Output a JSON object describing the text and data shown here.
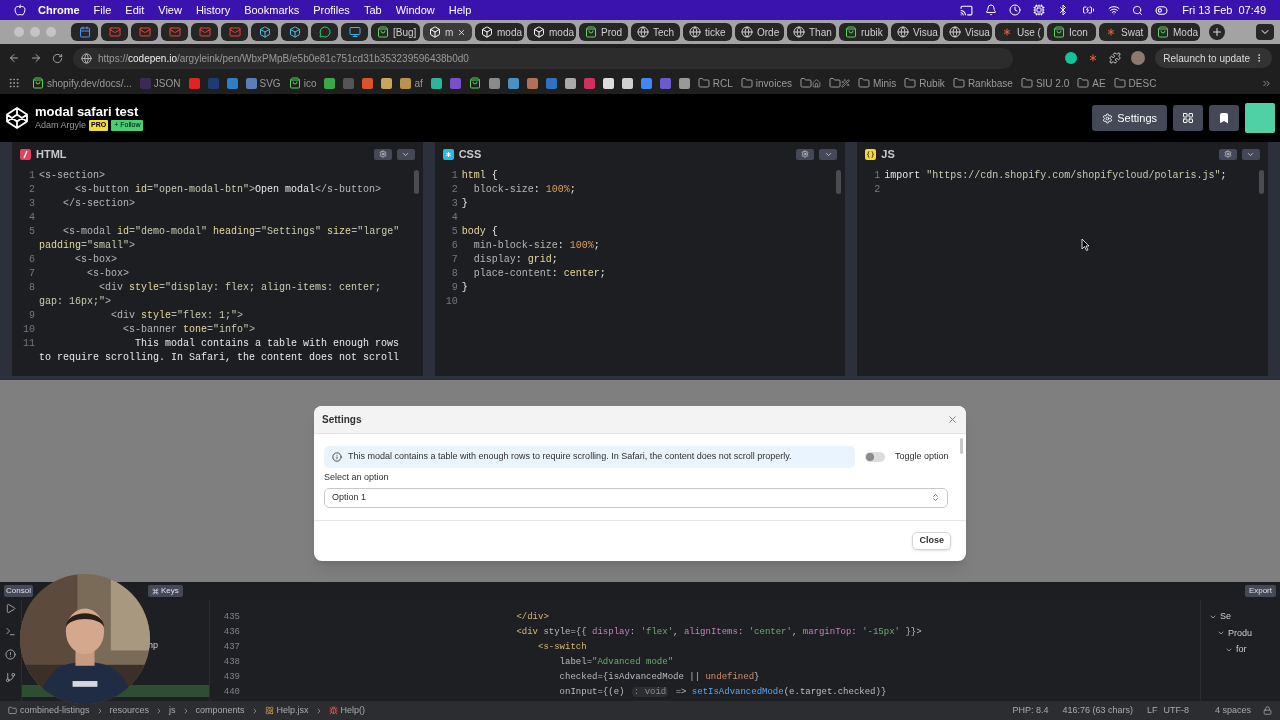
{
  "menubar": {
    "app": "Chrome",
    "items": [
      "File",
      "Edit",
      "View",
      "History",
      "Bookmarks",
      "Profiles",
      "Tab",
      "Window",
      "Help"
    ],
    "date": "Fri 13 Feb",
    "time": "07:49"
  },
  "tabs": [
    {
      "kind": "calendar",
      "selected": false
    },
    {
      "kind": "mail",
      "selected": false
    },
    {
      "kind": "mail",
      "selected": false
    },
    {
      "kind": "mail",
      "selected": false
    },
    {
      "kind": "mail",
      "selected": false
    },
    {
      "kind": "mail",
      "selected": false
    },
    {
      "kind": "cube",
      "selected": false
    },
    {
      "kind": "cube",
      "selected": false
    },
    {
      "kind": "chat",
      "selected": false
    },
    {
      "kind": "screen",
      "selected": false
    },
    {
      "kind": "shopify",
      "label": "[Bug]",
      "selected": false
    },
    {
      "kind": "codepen",
      "label": "m",
      "selected": true
    },
    {
      "kind": "codepen",
      "label": "moda",
      "selected": false
    },
    {
      "kind": "codepen",
      "label": "moda",
      "selected": false
    },
    {
      "kind": "shopify",
      "label": "Prod",
      "selected": false
    },
    {
      "kind": "globe",
      "label": "Tech",
      "selected": false
    },
    {
      "kind": "globe",
      "label": "ticke",
      "selected": false
    },
    {
      "kind": "globe",
      "label": "Orde",
      "selected": false
    },
    {
      "kind": "globe",
      "label": "Than",
      "selected": false
    },
    {
      "kind": "shopify",
      "label": "rubik",
      "selected": false
    },
    {
      "kind": "globe",
      "label": "Visua",
      "selected": false
    },
    {
      "kind": "globe",
      "label": "Visua",
      "selected": false
    },
    {
      "kind": "star",
      "label": "Use (",
      "selected": false
    },
    {
      "kind": "shopify",
      "label": "Icon",
      "selected": false
    },
    {
      "kind": "star",
      "label": "Swat",
      "selected": false
    },
    {
      "kind": "shopify",
      "label": "Moda",
      "selected": false
    }
  ],
  "address": {
    "scheme": "https://",
    "host": "codepen.io",
    "path": "/argyleink/pen/WbxPMpB/e5b0e81c751cd31b353239596438b0d0",
    "relaunch": "Relaunch to update"
  },
  "bookmarks": [
    {
      "kind": "shopify",
      "label": "shopify.dev/docs/..."
    },
    {
      "kind": "square",
      "color": "#3b2a55",
      "label": "JSON"
    },
    {
      "kind": "square",
      "color": "#e02424"
    },
    {
      "kind": "square",
      "color": "#1f3b73"
    },
    {
      "kind": "square",
      "color": "#2f7fc4"
    },
    {
      "kind": "square",
      "color": "#5a7fb8",
      "label": "SVG"
    },
    {
      "kind": "shopify",
      "label": "ico"
    },
    {
      "kind": "square",
      "color": "#3aa845"
    },
    {
      "kind": "square",
      "color": "#555555"
    },
    {
      "kind": "square",
      "color": "#d9542b"
    },
    {
      "kind": "square",
      "color": "#c9a45a"
    },
    {
      "kind": "square",
      "color": "#b8924e",
      "label": "af"
    },
    {
      "kind": "square",
      "color": "#2bb59a"
    },
    {
      "kind": "square",
      "color": "#7b4fc9"
    },
    {
      "kind": "shopify"
    },
    {
      "kind": "square",
      "color": "#8a8a8a"
    },
    {
      "kind": "square",
      "color": "#4a90c2"
    },
    {
      "kind": "square",
      "color": "#b0705a"
    },
    {
      "kind": "square",
      "color": "#3070c0"
    },
    {
      "kind": "square",
      "color": "#aaaaaa"
    },
    {
      "kind": "square",
      "color": "#d03060"
    },
    {
      "kind": "square",
      "color": "#dddddd"
    },
    {
      "kind": "square",
      "color": "#cfcfcf"
    },
    {
      "kind": "square",
      "color": "#4285f4"
    },
    {
      "kind": "square",
      "color": "#6a5acd"
    },
    {
      "kind": "square",
      "color": "#999999"
    },
    {
      "kind": "folder",
      "label": "RCL"
    },
    {
      "kind": "folder",
      "label": "invoices"
    },
    {
      "kind": "folder-house"
    },
    {
      "kind": "folder-wand"
    },
    {
      "kind": "folder",
      "label": "Minis"
    },
    {
      "kind": "folder",
      "label": "Rubik"
    },
    {
      "kind": "folder",
      "label": "Rankbase"
    },
    {
      "kind": "folder",
      "label": "SIU 2.0"
    },
    {
      "kind": "folder",
      "label": "AE"
    },
    {
      "kind": "folder",
      "label": "DESC"
    }
  ],
  "pen": {
    "title": "modal safari test",
    "author": "Adam Argyle",
    "badge": "PRO",
    "follow": "+ Follow",
    "settings": "Settings"
  },
  "editors": [
    {
      "kind": "html",
      "name": "HTML",
      "rows": [
        {
          "n": "1",
          "seg": [
            {
              "kind": "tag",
              "text": "<s-section>"
            }
          ]
        },
        {
          "n": "2",
          "seg": [
            {
              "kind": "tag",
              "text": "      <s-button"
            },
            {
              "kind": "attr",
              "text": " id"
            },
            {
              "kind": "tag",
              "text": "="
            },
            {
              "kind": "str",
              "text": "\"open-modal-btn\""
            },
            {
              "kind": "tag",
              "text": ">"
            },
            {
              "kind": "text",
              "text": "Open modal"
            },
            {
              "kind": "tag",
              "text": "</s-button>"
            }
          ]
        },
        {
          "n": "3",
          "seg": [
            {
              "kind": "tag",
              "text": "    </s-section>"
            }
          ]
        },
        {
          "n": "4",
          "seg": []
        },
        {
          "n": "5",
          "seg": [
            {
              "kind": "tag",
              "text": "    <s-modal"
            },
            {
              "kind": "attr",
              "text": " id"
            },
            {
              "kind": "tag",
              "text": "="
            },
            {
              "kind": "str",
              "text": "\"demo-modal\""
            },
            {
              "kind": "attr",
              "text": " heading"
            },
            {
              "kind": "tag",
              "text": "="
            },
            {
              "kind": "str",
              "text": "\"Settings\""
            },
            {
              "kind": "attr",
              "text": " size"
            },
            {
              "kind": "tag",
              "text": "="
            },
            {
              "kind": "str",
              "text": "\"large\""
            }
          ]
        },
        {
          "seg": [
            {
              "kind": "attr",
              "text": "padding"
            },
            {
              "kind": "tag",
              "text": "="
            },
            {
              "kind": "str",
              "text": "\"small\""
            },
            {
              "kind": "tag",
              "text": ">"
            }
          ]
        },
        {
          "n": "6",
          "seg": [
            {
              "kind": "tag",
              "text": "      <s-box>"
            }
          ]
        },
        {
          "n": "7",
          "seg": [
            {
              "kind": "tag",
              "text": "        <s-box>"
            }
          ]
        },
        {
          "n": "8",
          "seg": [
            {
              "kind": "tag",
              "text": "          <div"
            },
            {
              "kind": "attr",
              "text": " style"
            },
            {
              "kind": "tag",
              "text": "="
            },
            {
              "kind": "str",
              "text": "\"display: flex; align-items: center;"
            }
          ]
        },
        {
          "seg": [
            {
              "kind": "str",
              "text": "gap: 16px;\""
            },
            {
              "kind": "tag",
              "text": ">"
            }
          ]
        },
        {
          "n": "9",
          "seg": [
            {
              "kind": "tag",
              "text": "            <div"
            },
            {
              "kind": "attr",
              "text": " style"
            },
            {
              "kind": "tag",
              "text": "="
            },
            {
              "kind": "str",
              "text": "\"flex: 1;\""
            },
            {
              "kind": "tag",
              "text": ">"
            }
          ]
        },
        {
          "n": "10",
          "seg": [
            {
              "kind": "tag",
              "text": "              <s-banner"
            },
            {
              "kind": "attr",
              "text": " tone"
            },
            {
              "kind": "tag",
              "text": "="
            },
            {
              "kind": "str",
              "text": "\"info\""
            },
            {
              "kind": "tag",
              "text": ">"
            }
          ]
        },
        {
          "n": "11",
          "seg": [
            {
              "kind": "text",
              "text": "                This modal contains a table with enough rows"
            }
          ]
        },
        {
          "seg": [
            {
              "kind": "text",
              "text": "to require scrolling. In Safari, the content does not scroll"
            }
          ]
        }
      ]
    },
    {
      "kind": "css",
      "name": "CSS",
      "rows": [
        {
          "n": "1",
          "seg": [
            {
              "kind": "attr",
              "text": "html"
            },
            {
              "kind": "text",
              "text": " {"
            }
          ]
        },
        {
          "n": "2",
          "seg": [
            {
              "kind": "tag",
              "text": "  block-size"
            },
            {
              "kind": "text",
              "text": ": "
            },
            {
              "kind": "num",
              "text": "100%"
            },
            {
              "kind": "text",
              "text": ";"
            }
          ]
        },
        {
          "n": "3",
          "seg": [
            {
              "kind": "text",
              "text": "}"
            }
          ]
        },
        {
          "n": "4",
          "seg": []
        },
        {
          "n": "5",
          "seg": [
            {
              "kind": "attr",
              "text": "body"
            },
            {
              "kind": "text",
              "text": " {"
            }
          ]
        },
        {
          "n": "6",
          "seg": [
            {
              "kind": "tag",
              "text": "  min-block-size"
            },
            {
              "kind": "text",
              "text": ": "
            },
            {
              "kind": "num",
              "text": "100%"
            },
            {
              "kind": "text",
              "text": ";"
            }
          ]
        },
        {
          "n": "7",
          "seg": [
            {
              "kind": "tag",
              "text": "  display"
            },
            {
              "kind": "text",
              "text": ": "
            },
            {
              "kind": "attr",
              "text": "grid"
            },
            {
              "kind": "text",
              "text": ";"
            }
          ]
        },
        {
          "n": "8",
          "seg": [
            {
              "kind": "tag",
              "text": "  place-content"
            },
            {
              "kind": "text",
              "text": ": "
            },
            {
              "kind": "attr",
              "text": "center"
            },
            {
              "kind": "text",
              "text": ";"
            }
          ]
        },
        {
          "n": "9",
          "seg": [
            {
              "kind": "text",
              "text": "}"
            }
          ]
        },
        {
          "n": "10",
          "seg": []
        }
      ]
    },
    {
      "kind": "js",
      "name": "JS",
      "rows": [
        {
          "n": "1",
          "seg": [
            {
              "kind": "text",
              "text": "import "
            },
            {
              "kind": "str",
              "text": "\"https://cdn.shopify.com/shopifycloud/polaris.js\""
            },
            {
              "kind": "text",
              "text": ";"
            }
          ]
        },
        {
          "n": "2",
          "seg": []
        }
      ]
    }
  ],
  "modal": {
    "title": "Settings",
    "banner": "This modal contains a table with enough rows to require scrolling. In Safari, the content does not scroll properly.",
    "toggle": {
      "label": "Toggle option",
      "on": false
    },
    "select": {
      "label": "Select an option",
      "value": "Option 1"
    },
    "close": "Close"
  },
  "pen_footer": {
    "console": "Consol",
    "keys": "Keys",
    "export": "Export"
  },
  "ide": {
    "file_item": "hp",
    "lines": [
      {
        "n": "435",
        "seg": [
          {
            "kind": "itag",
            "text": "                </div>"
          }
        ]
      },
      {
        "n": "436",
        "seg": [
          {
            "kind": "itag",
            "text": "                <div"
          },
          {
            "kind": "iattr",
            "text": " style"
          },
          {
            "kind": "itext",
            "text": "={{ "
          },
          {
            "kind": "field",
            "text": "display"
          },
          {
            "kind": "itext",
            "text": ": "
          },
          {
            "kind": "istr",
            "text": "'flex'"
          },
          {
            "kind": "itext",
            "text": ", "
          },
          {
            "kind": "field",
            "text": "alignItems"
          },
          {
            "kind": "itext",
            "text": ": "
          },
          {
            "kind": "istr",
            "text": "'center'"
          },
          {
            "kind": "itext",
            "text": ", "
          },
          {
            "kind": "field",
            "text": "marginTop"
          },
          {
            "kind": "itext",
            "text": ": "
          },
          {
            "kind": "istr",
            "text": "'-15px'"
          },
          {
            "kind": "itext",
            "text": " }}>"
          }
        ]
      },
      {
        "n": "437",
        "seg": [
          {
            "kind": "itag",
            "text": "                    <s-switch"
          }
        ]
      },
      {
        "n": "438",
        "seg": [
          {
            "kind": "iattr",
            "text": "                        label"
          },
          {
            "kind": "itext",
            "text": "="
          },
          {
            "kind": "istr",
            "text": "\"Advanced mode\""
          }
        ]
      },
      {
        "n": "439",
        "seg": [
          {
            "kind": "iattr",
            "text": "                        checked"
          },
          {
            "kind": "itext",
            "text": "={isAdvancedMode || "
          },
          {
            "kind": "kw",
            "text": "undefined"
          },
          {
            "kind": "itext",
            "text": "}"
          }
        ]
      },
      {
        "n": "440",
        "seg": [
          {
            "kind": "iattr",
            "text": "                        onInput"
          },
          {
            "kind": "itext",
            "text": "={(e) "
          },
          {
            "kind": "hint",
            "text": ": void"
          },
          {
            "kind": "itext",
            "text": " => "
          },
          {
            "kind": "fn",
            "text": "setIsAdvancedMode"
          },
          {
            "kind": "itext",
            "text": "(e.target.checked)}"
          }
        ]
      }
    ],
    "tree": [
      "Se",
      "Produ",
      "for"
    ],
    "breadcrumbs": [
      {
        "kind": "folder",
        "label": "combined-listings"
      },
      {
        "kind": "plain",
        "label": "resources"
      },
      {
        "kind": "plain",
        "label": "js"
      },
      {
        "kind": "plain",
        "label": "components"
      },
      {
        "kind": "react",
        "label": "Help.jsx"
      },
      {
        "kind": "error",
        "label": "Help()"
      }
    ],
    "status": {
      "php": "PHP: 8.4",
      "position": "416:76 (63 chars)",
      "line_ending": "LF",
      "encoding": "UTF-8",
      "indent": "4 spaces"
    }
  }
}
